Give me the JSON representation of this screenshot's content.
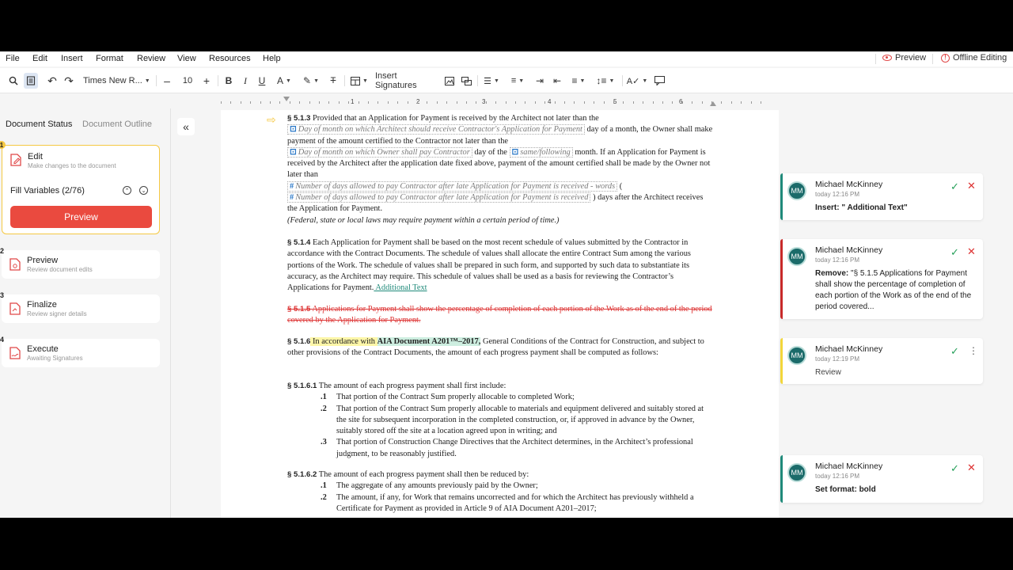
{
  "menu": [
    "File",
    "Edit",
    "Insert",
    "Format",
    "Review",
    "View",
    "Resources",
    "Help"
  ],
  "top_right": {
    "preview_label": "Preview",
    "offline_label": "Offline Editing"
  },
  "toolbar": {
    "font_name": "Times New R...",
    "font_size": "10",
    "insert_signatures": "Insert Signatures"
  },
  "ruler": [
    "1",
    "2",
    "3",
    "4",
    "5",
    "6"
  ],
  "left_panel": {
    "tabs": [
      "Document Status",
      "Document Outline"
    ],
    "steps": [
      {
        "num": "1",
        "title": "Edit",
        "subtitle": "Make changes to the document"
      },
      {
        "num": "2",
        "title": "Preview",
        "subtitle": "Review document edits"
      },
      {
        "num": "3",
        "title": "Finalize",
        "subtitle": "Review signer details"
      },
      {
        "num": "4",
        "title": "Execute",
        "subtitle": "Awaiting Signatures"
      }
    ],
    "fill_variables": "Fill Variables (2/76)",
    "preview_button": "Preview"
  },
  "document": {
    "p513_num": "§ 5.1.3",
    "p513_a": " Provided that an Application for Payment is received by the Architect not later than the",
    "p513_var1": "Day of month on which Architect should receive Contractor's Application for Payment",
    "p513_b": " day of a month, the Owner shall make payment of the amount certified to the Contractor not later than the",
    "p513_var2": "Day of month on which Owner shall pay Contractor",
    "p513_c": " day of the ",
    "p513_var3": "same/following",
    "p513_d": " month. If an Application for Payment is received by the Architect after the application date fixed above, payment of the amount certified shall be made by the Owner not later than",
    "p513_var4": "Number of days allowed to pay Contractor after late Application for Payment is received - words",
    "p513_e": " (",
    "p513_var5": "Number of days allowed to pay Contractor after late Application for Payment is received",
    "p513_f": " ) days after the Architect receives the Application for Payment.",
    "p513_note": "(Federal, state or local laws may require payment within a certain period of time.)",
    "p514_num": "§ 5.1.4",
    "p514_text": " Each Application for Payment shall be based on the most recent schedule of values submitted by the Contractor in accordance with the Contract Documents. The schedule of values shall allocate the entire Contract Sum among the various portions of the Work. The schedule of values shall be prepared in such form, and supported by such data to substantiate its accuracy, as the Architect may require. This schedule of values shall be used as a basis for reviewing the Contractor’s Applications for Payment.",
    "p514_ins": " Additional Text",
    "p515_num": "§ 5.1.5",
    "p515_text": " Applications for Payment shall show the percentage of completion of each portion of the Work as of the end of the period covered by the Application for Payment.",
    "p516_num": "§ 5.1.6",
    "p516_hl": " In accordance with ",
    "p516_bold": "AIA Document A201™–2017,",
    "p516_text": " General Conditions of the Contract for Construction, and subject to other provisions of the Contract Documents, the amount of each progress payment shall be computed as follows:",
    "p5161_num": "§ 5.1.6.1",
    "p5161_text": " The amount of each progress payment shall first include:",
    "p5161_items": [
      {
        "n": ".1",
        "t": "That portion of the Contract Sum properly allocable to completed Work;"
      },
      {
        "n": ".2",
        "t": "That portion of the Contract Sum properly allocable to materials and equipment delivered and suitably stored at the site for subsequent incorporation in the completed construction, or, if approved in advance by the Owner, suitably stored off the site at a location agreed upon in writing; and"
      },
      {
        "n": ".3",
        "t": "That portion of Construction Change Directives that the Architect determines, in the Architect’s professional judgment, to be reasonably justified."
      }
    ],
    "p5162_num": "§ 5.1.6.2",
    "p5162_text": " The amount of each progress payment shall then be reduced by:",
    "p5162_items": [
      {
        "n": ".1",
        "t": "The aggregate of any amounts previously paid by the Owner;"
      },
      {
        "n": ".2",
        "t": "The amount, if any, for Work that remains uncorrected and for which the Architect has previously withheld a Certificate for Payment as provided in Article 9 of AIA Document A201–2017;"
      }
    ]
  },
  "comments": [
    {
      "avatar": "MM",
      "name": "Michael McKinney",
      "time": "today 12:16 PM",
      "label": "Insert:",
      "body": " \" Additional Text\"",
      "color": "#1f8a7a"
    },
    {
      "avatar": "MM",
      "name": "Michael McKinney",
      "time": "today 12:16 PM",
      "label": "Remove:",
      "body": " \"§ 5.1.5 Applications for Payment shall show the percentage of completion of each portion of the Work as of the end of the period covered...",
      "color": "#c82a2a"
    },
    {
      "avatar": "MM",
      "name": "Michael McKinney",
      "time": "today 12:19 PM",
      "label": "",
      "body": "Review",
      "color": "#f2d63a"
    },
    {
      "avatar": "MM",
      "name": "Michael McKinney",
      "time": "today 12:16 PM",
      "label": "Set format:",
      "body": " bold",
      "color": "#1f8a7a"
    }
  ]
}
